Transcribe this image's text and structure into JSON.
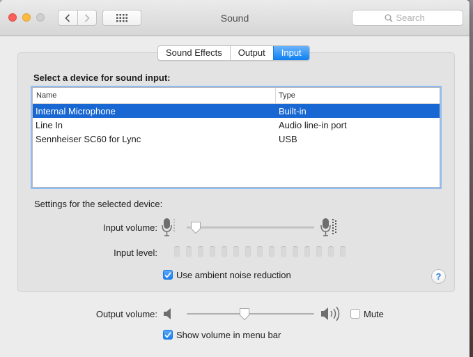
{
  "window": {
    "title": "Sound",
    "search_placeholder": "Search"
  },
  "tabs": [
    {
      "label": "Sound Effects",
      "active": false
    },
    {
      "label": "Output",
      "active": false
    },
    {
      "label": "Input",
      "active": true
    }
  ],
  "input": {
    "section_label": "Select a device for sound input:",
    "columns": [
      "Name",
      "Type"
    ],
    "devices": [
      {
        "name": "Internal Microphone",
        "type": "Built-in",
        "selected": true
      },
      {
        "name": "Line In",
        "type": "Audio line-in port",
        "selected": false
      },
      {
        "name": "Sennheiser SC60 for Lync",
        "type": "USB",
        "selected": false
      }
    ],
    "settings_label": "Settings for the selected device:",
    "input_volume_label": "Input volume:",
    "input_volume_fraction": 0.04,
    "input_level_label": "Input level:",
    "input_level_segments": 15,
    "input_level_active": 0,
    "noise_reduction_label": "Use ambient noise reduction",
    "noise_reduction_checked": true
  },
  "output": {
    "volume_label": "Output volume:",
    "volume_fraction": 0.45,
    "mute_label": "Mute",
    "mute_checked": false,
    "show_in_menu_bar_label": "Show volume in menu bar",
    "show_in_menu_bar_checked": true
  },
  "help_label": "?",
  "colors": {
    "accent": "#1967d2",
    "tab_active": "#0d80f2",
    "checkbox_on": "#1a7ff0"
  },
  "icons": [
    "chevron-left-icon",
    "chevron-right-icon",
    "grid-icon",
    "search-icon",
    "microphone-icon",
    "speaker-low-icon",
    "speaker-high-icon",
    "checkmark-icon",
    "help-icon"
  ]
}
